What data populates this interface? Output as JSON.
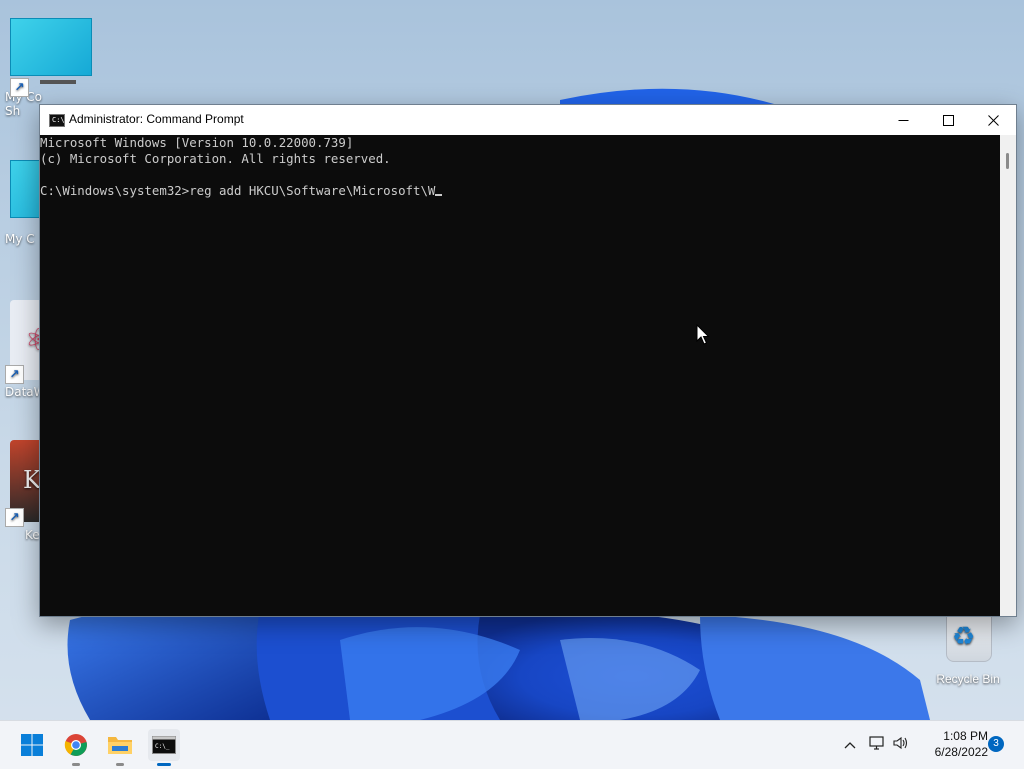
{
  "window": {
    "title": "Administrator: Command Prompt",
    "icon_text": "C:\\",
    "minimize_glyph": "—",
    "maximize_glyph": "☐",
    "close_glyph": "✕"
  },
  "console": {
    "lines": [
      "Microsoft Windows [Version 10.0.22000.739]",
      "(c) Microsoft Corporation. All rights reserved.",
      "",
      "C:\\Windows\\system32>reg add HKCU\\Software\\Microsoft\\W"
    ]
  },
  "desktop": {
    "icons": [
      {
        "label": "My Co\nSh",
        "icon": "monitor-shortcut-icon"
      },
      {
        "label": "My C",
        "icon": "monitor-icon"
      },
      {
        "label": "DataW",
        "icon": "datawrapper-shortcut-icon"
      },
      {
        "label": "Ke",
        "icon": "app-shortcut-icon"
      }
    ],
    "recycle_bin": {
      "label": "Recycle Bin",
      "icon": "recycle-bin-icon"
    }
  },
  "taskbar": {
    "apps": [
      {
        "name": "start",
        "icon": "windows-start-icon"
      },
      {
        "name": "chrome",
        "icon": "chrome-icon"
      },
      {
        "name": "file-explorer",
        "icon": "folder-icon"
      },
      {
        "name": "command-prompt",
        "icon": "terminal-icon"
      }
    ],
    "tray": {
      "time": "1:08 PM",
      "date": "6/28/2022",
      "notification_count": "3"
    }
  },
  "colors": {
    "console_bg": "#0c0c0c",
    "console_fg": "#cccccc",
    "accent": "#0067c0"
  }
}
